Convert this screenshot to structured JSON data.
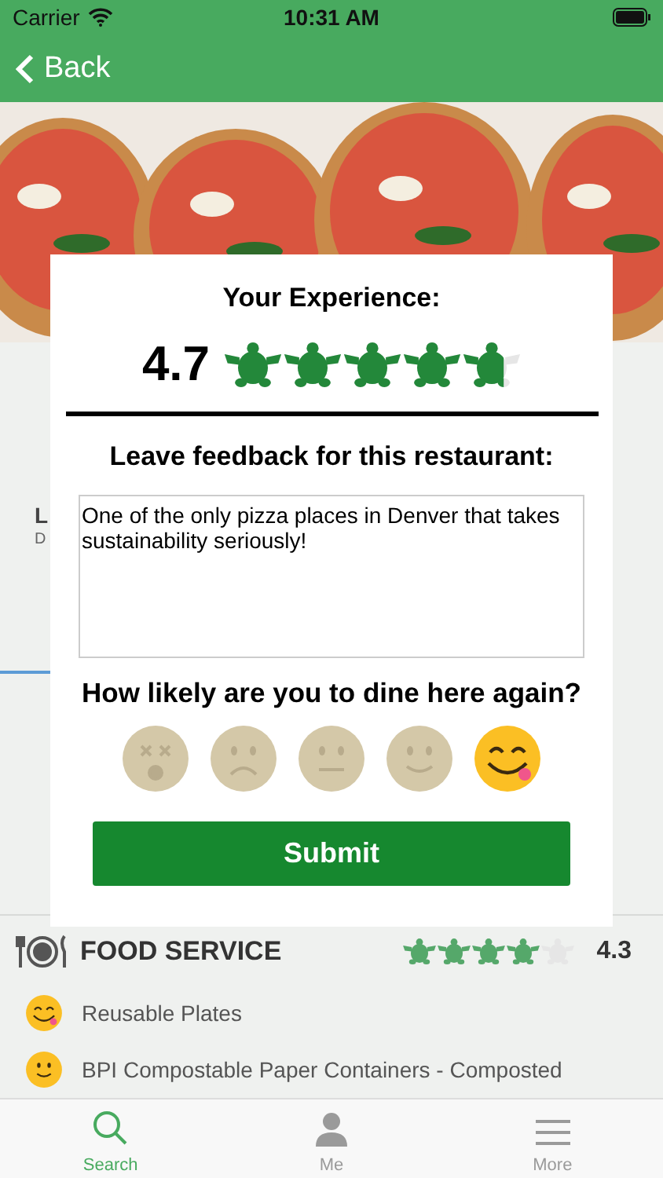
{
  "status_bar": {
    "carrier": "Carrier",
    "time": "10:31 AM"
  },
  "nav": {
    "back": "Back"
  },
  "behind": {
    "title": "L",
    "subtitle": "D"
  },
  "review_card": {
    "title": "Your Experience:",
    "score": "4.7",
    "stars": 4.7,
    "feedback_label": "Leave feedback for this restaurant:",
    "feedback": "One of the only pizza places in Denver that takes sustainability seriously!",
    "question": "How likely are you to dine here again?",
    "faces": [
      {
        "kind": "dizzy",
        "selected": false
      },
      {
        "kind": "frown",
        "selected": false
      },
      {
        "kind": "neutral",
        "selected": false
      },
      {
        "kind": "smile",
        "selected": false
      },
      {
        "kind": "yum",
        "selected": true
      }
    ],
    "submit": "Submit"
  },
  "category": {
    "title": "FOOD SERVICE",
    "stars": 4,
    "score": "4.3",
    "items": [
      {
        "kind": "yum",
        "label": "Reusable Plates"
      },
      {
        "kind": "smile",
        "label": "BPI Compostable Paper Containers - Composted"
      }
    ]
  },
  "tab_bar": [
    {
      "label": "Search",
      "selected": true
    },
    {
      "label": "Me",
      "selected": false
    },
    {
      "label": "More",
      "selected": false
    }
  ]
}
